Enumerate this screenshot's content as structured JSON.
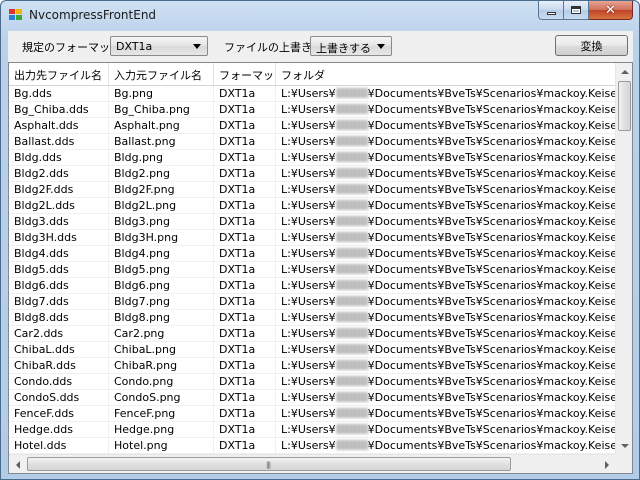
{
  "window": {
    "title": "NvcompressFrontEnd"
  },
  "toolbar": {
    "format_label": "規定のフォーマット",
    "format_value": "DXT1a",
    "overwrite_label": "ファイルの上書き",
    "overwrite_value": "上書きする",
    "convert_label": "変換"
  },
  "grid": {
    "columns": [
      "出力先ファイル名",
      "入力元ファイル名",
      "フォーマット",
      "フォルダ"
    ],
    "folder_prefix": "L:¥Users¥",
    "folder_suffix": "¥Documents¥BveTs¥Scenarios¥mackoy.Keisei¥Str",
    "rows": [
      [
        "Bg.dds",
        "Bg.png",
        "DXT1a"
      ],
      [
        "Bg_Chiba.dds",
        "Bg_Chiba.png",
        "DXT1a"
      ],
      [
        "Asphalt.dds",
        "Asphalt.png",
        "DXT1a"
      ],
      [
        "Ballast.dds",
        "Ballast.png",
        "DXT1a"
      ],
      [
        "Bldg.dds",
        "Bldg.png",
        "DXT1a"
      ],
      [
        "Bldg2.dds",
        "Bldg2.png",
        "DXT1a"
      ],
      [
        "Bldg2F.dds",
        "Bldg2F.png",
        "DXT1a"
      ],
      [
        "Bldg2L.dds",
        "Bldg2L.png",
        "DXT1a"
      ],
      [
        "Bldg3.dds",
        "Bldg3.png",
        "DXT1a"
      ],
      [
        "Bldg3H.dds",
        "Bldg3H.png",
        "DXT1a"
      ],
      [
        "Bldg4.dds",
        "Bldg4.png",
        "DXT1a"
      ],
      [
        "Bldg5.dds",
        "Bldg5.png",
        "DXT1a"
      ],
      [
        "Bldg6.dds",
        "Bldg6.png",
        "DXT1a"
      ],
      [
        "Bldg7.dds",
        "Bldg7.png",
        "DXT1a"
      ],
      [
        "Bldg8.dds",
        "Bldg8.png",
        "DXT1a"
      ],
      [
        "Car2.dds",
        "Car2.png",
        "DXT1a"
      ],
      [
        "ChibaL.dds",
        "ChibaL.png",
        "DXT1a"
      ],
      [
        "ChibaR.dds",
        "ChibaR.png",
        "DXT1a"
      ],
      [
        "Condo.dds",
        "Condo.png",
        "DXT1a"
      ],
      [
        "CondoS.dds",
        "CondoS.png",
        "DXT1a"
      ],
      [
        "FenceF.dds",
        "FenceF.png",
        "DXT1a"
      ],
      [
        "Hedge.dds",
        "Hedge.png",
        "DXT1a"
      ],
      [
        "Hotel.dds",
        "Hotel.png",
        "DXT1a"
      ]
    ]
  },
  "colors": {
    "close_button": "#c0432b",
    "titlebar": "#b9d1ea",
    "app_icon": [
      "#e0332b",
      "#f4b400",
      "#2f7fd8",
      "#3aa83a"
    ]
  },
  "icons": {
    "app": "app-icon",
    "minimize": "minimize-icon",
    "maximize": "maximize-icon",
    "close": "close-icon",
    "dropdown": "chevron-down-icon"
  }
}
